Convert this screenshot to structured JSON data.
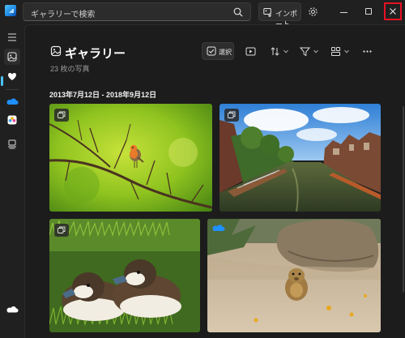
{
  "window": {
    "search_placeholder": "ギャラリーで検索",
    "import_label": "インポート"
  },
  "nav": {
    "items": [
      {
        "name": "menu",
        "icon": "hamburger-menu-icon"
      },
      {
        "name": "gallery",
        "icon": "gallery-icon",
        "selected": true
      },
      {
        "name": "favorites",
        "icon": "heart-icon"
      },
      {
        "name": "onedrive",
        "icon": "onedrive-cloud-icon"
      },
      {
        "name": "icloud",
        "icon": "icloud-photos-icon"
      },
      {
        "name": "external",
        "icon": "external-device-icon"
      },
      {
        "name": "cloud-account",
        "icon": "cloud-icon"
      }
    ]
  },
  "page": {
    "title": "ギャラリー",
    "count": "23 枚の写真",
    "select_label": "選択",
    "date_range": "2013年7月12日 - 2018年9月12日"
  },
  "toolbar": {
    "icons": [
      "select-checkbox-icon",
      "slideshow-icon",
      "sort-icon",
      "filter-icon",
      "view-layout-icon",
      "more-icon"
    ]
  },
  "colors": {
    "accent": "#4cc2ff",
    "close_highlight": "#e81123",
    "background": "#1c1c1c"
  },
  "photos": [
    {
      "subject": "robin-on-branch",
      "badge": "multiple-photos-icon"
    },
    {
      "subject": "amsterdam-canal",
      "badge": "multiple-photos-icon"
    },
    {
      "subject": "ducklings-in-grass",
      "badge": "multiple-photos-icon"
    },
    {
      "subject": "prairie-dog-on-sand",
      "badge": "onedrive-cloud-icon"
    }
  ]
}
